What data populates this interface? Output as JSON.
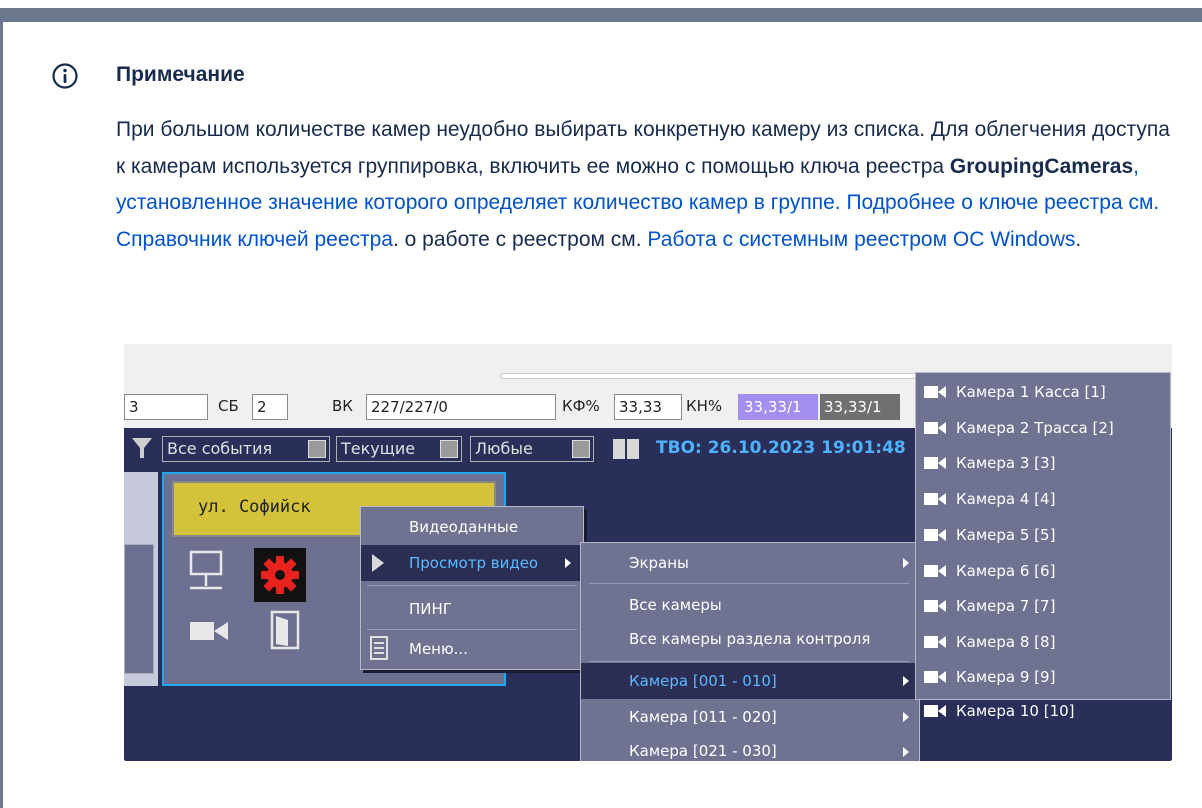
{
  "note": {
    "title": "Примечание",
    "body_1": "При большом количестве камер неудобно выбирать конкретную камеру из списка. Для облегчения доступа к камерам используется группировка, включить ее можно с помощью ключа реестра ",
    "registry_key": "GroupingCameras",
    "body_2": ", установленное значение которого определяет количество камер в группе. Подробнее о ключе реестра см. ",
    "link_registry_ref": "Справочник ключей реестра",
    "body_3": ". о работе с реестром см. ",
    "link_system_registry": "Работа с системным реестром ОС Windows",
    "body_4": "."
  },
  "screenshot": {
    "status": {
      "field_first": "3",
      "sb_label": "СБ",
      "sb_value": "2",
      "vk_label": "ВК",
      "vk_value": "227/227/0",
      "kf_label": "КФ%",
      "kf_value": "33,33",
      "kn_label": "КН%",
      "kn_value_1": "33,33/1",
      "kn_value_2": "33,33/1"
    },
    "filters": {
      "all_events": "Все события",
      "current": "Текущие",
      "any": "Любые",
      "tvo": "ТВО: 26.10.2023 19:01:48"
    },
    "street": "ул. Софийск",
    "context_menu": {
      "video_data": "Видеоданные",
      "view_video": "Просмотр видео",
      "ping": "ПИНГ",
      "menu": "Меню..."
    },
    "submenu": {
      "screens": "Экраны",
      "all_cameras": "Все камеры",
      "all_cameras_section": "Все камеры раздела контроля",
      "group_1": "Камера [001 - 010]",
      "group_2": "Камера [011 - 020]",
      "group_3": "Камера [021 - 030]"
    },
    "cameras": [
      "Камера 1 Касса [1]",
      "Камера 2 Трасса [2]",
      "Камера 3 [3]",
      "Камера 4 [4]",
      "Камера 5 [5]",
      "Камера 6 [6]",
      "Камера 7 [7]",
      "Камера 8 [8]",
      "Камера 9 [9]",
      "Камера 10 [10]"
    ]
  }
}
